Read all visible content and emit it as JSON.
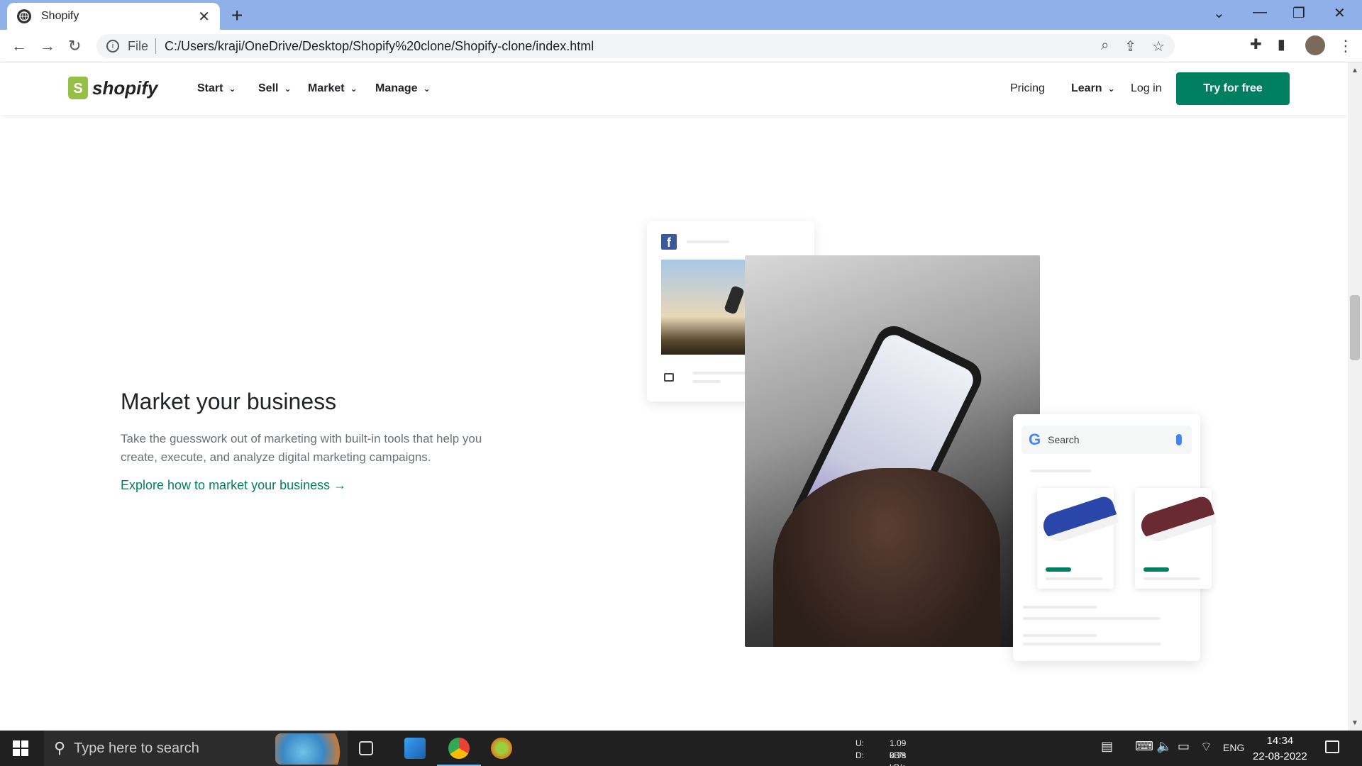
{
  "browser": {
    "tab_title": "Shopify",
    "new_tab": "+",
    "scheme": "File",
    "url": "C:/Users/kraji/OneDrive/Desktop/Shopify%20clone/Shopify-clone/index.html"
  },
  "site": {
    "logo_text": "shopify",
    "nav": [
      {
        "label": "Start"
      },
      {
        "label": "Sell"
      },
      {
        "label": "Market"
      },
      {
        "label": "Manage"
      }
    ],
    "pricing": "Pricing",
    "learn": "Learn",
    "login": "Log in",
    "cta": "Try for free"
  },
  "main": {
    "heading": "Market your business",
    "description": "Take the guesswork out of marketing with built-in tools that help you create, execute, and analyze digital marketing campaigns.",
    "link": "Explore how to market your business →"
  },
  "illustration": {
    "search_placeholder": "Search",
    "shoe_colors": [
      "#2a46a8",
      "#6a2a34"
    ]
  },
  "taskbar": {
    "search_placeholder": "Type here to search",
    "net_up_label": "U:",
    "net_up": "1.09 kB/s",
    "net_down_label": "D:",
    "net_down": "0.78 kB/s",
    "lang": "ENG",
    "time": "14:34",
    "date": "22-08-2022"
  }
}
